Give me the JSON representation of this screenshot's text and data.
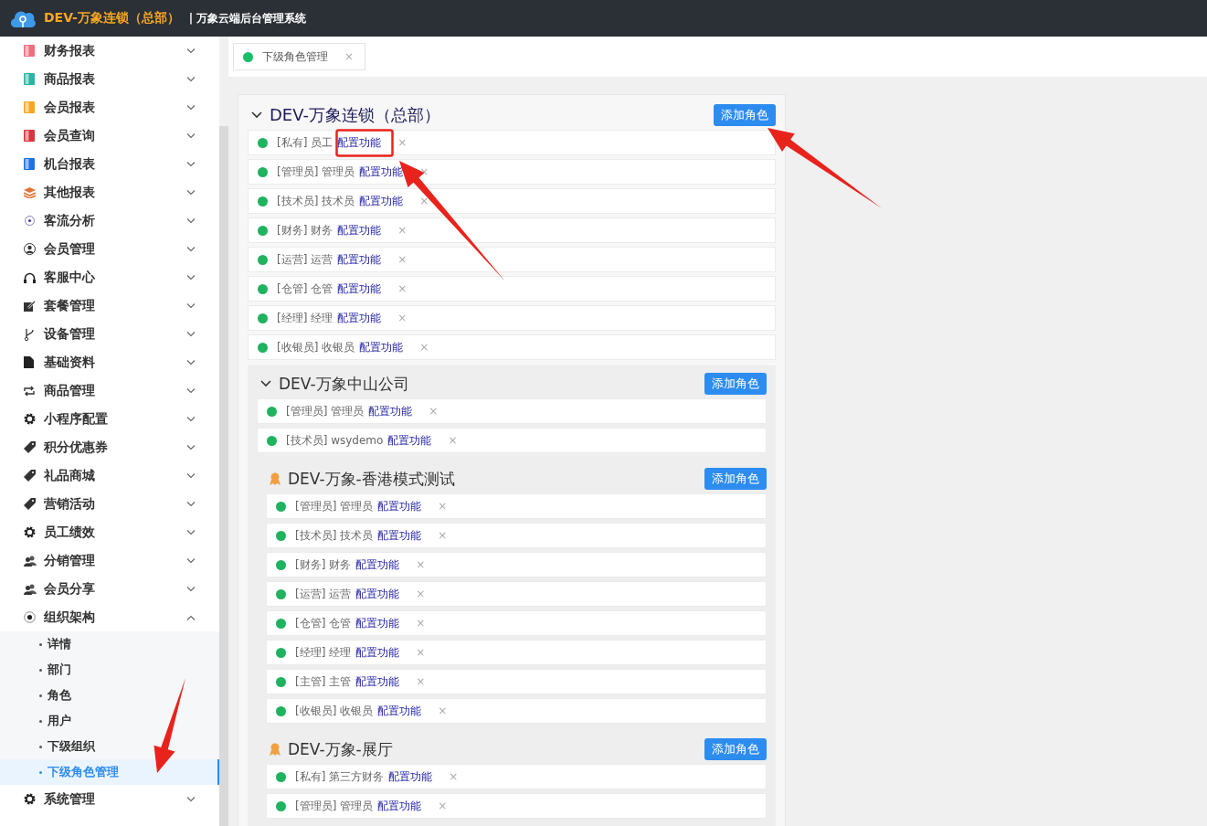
{
  "header": {
    "brand": "DEV-万象连锁（总部）",
    "subtitle": "| 万象云端后台管理系统"
  },
  "sidebar": {
    "items": [
      {
        "label": "财务报表",
        "expanded": false
      },
      {
        "label": "商品报表",
        "expanded": false
      },
      {
        "label": "会员报表",
        "expanded": false
      },
      {
        "label": "会员查询",
        "expanded": false
      },
      {
        "label": "机台报表",
        "expanded": false
      },
      {
        "label": "其他报表",
        "expanded": false
      },
      {
        "label": "客流分析",
        "expanded": false
      },
      {
        "label": "会员管理",
        "expanded": false
      },
      {
        "label": "客服中心",
        "expanded": false
      },
      {
        "label": "套餐管理",
        "expanded": false
      },
      {
        "label": "设备管理",
        "expanded": false
      },
      {
        "label": "基础资料",
        "expanded": false
      },
      {
        "label": "商品管理",
        "expanded": false
      },
      {
        "label": "小程序配置",
        "expanded": false
      },
      {
        "label": "积分优惠券",
        "expanded": false
      },
      {
        "label": "礼品商城",
        "expanded": false
      },
      {
        "label": "营销活动",
        "expanded": false
      },
      {
        "label": "员工绩效",
        "expanded": false
      },
      {
        "label": "分销管理",
        "expanded": false
      },
      {
        "label": "会员分享",
        "expanded": false
      },
      {
        "label": "组织架构",
        "expanded": true,
        "children": [
          {
            "label": "详情",
            "selected": false
          },
          {
            "label": "部门",
            "selected": false
          },
          {
            "label": "角色",
            "selected": false
          },
          {
            "label": "用户",
            "selected": false
          },
          {
            "label": "下级组织",
            "selected": false
          },
          {
            "label": "下级角色管理",
            "selected": true
          }
        ]
      },
      {
        "label": "系统管理",
        "expanded": false
      }
    ]
  },
  "tabs": [
    {
      "label": "下级角色管理",
      "selected": true,
      "close": "×"
    }
  ],
  "tree": {
    "kind": "branch",
    "name": "DEV-万象连锁（总部）",
    "expanded": true,
    "button": "添加角色",
    "roles": [
      {
        "tag": "[私有]",
        "name": "员工",
        "link": "配置功能",
        "close": "×"
      },
      {
        "tag": "[管理员]",
        "name": "管理员",
        "link": "配置功能",
        "close": "×"
      },
      {
        "tag": "[技术员]",
        "name": "技术员",
        "link": "配置功能",
        "close": "×"
      },
      {
        "tag": "[财务]",
        "name": "财务",
        "link": "配置功能",
        "close": "×"
      },
      {
        "tag": "[运营]",
        "name": "运营",
        "link": "配置功能",
        "close": "×"
      },
      {
        "tag": "[仓管]",
        "name": "仓管",
        "link": "配置功能",
        "close": "×"
      },
      {
        "tag": "[经理]",
        "name": "经理",
        "link": "配置功能",
        "close": "×"
      },
      {
        "tag": "[收银员]",
        "name": "收银员",
        "link": "配置功能",
        "close": "×"
      }
    ],
    "children": [
      {
        "kind": "branch",
        "name": "DEV-万象中山公司",
        "expanded": true,
        "button": "添加角色",
        "roles": [
          {
            "tag": "[管理员]",
            "name": "管理员",
            "link": "配置功能",
            "close": "×"
          },
          {
            "tag": "[技术员]",
            "name": "wsydemo",
            "link": "配置功能",
            "close": "×"
          }
        ],
        "children": [
          {
            "kind": "leaf",
            "name": "DEV-万象-香港模式测试",
            "button": "添加角色",
            "roles": [
              {
                "tag": "[管理员]",
                "name": "管理员",
                "link": "配置功能",
                "close": "×"
              },
              {
                "tag": "[技术员]",
                "name": "技术员",
                "link": "配置功能",
                "close": "×"
              },
              {
                "tag": "[财务]",
                "name": "财务",
                "link": "配置功能",
                "close": "×"
              },
              {
                "tag": "[运营]",
                "name": "运营",
                "link": "配置功能",
                "close": "×"
              },
              {
                "tag": "[仓管]",
                "name": "仓管",
                "link": "配置功能",
                "close": "×"
              },
              {
                "tag": "[经理]",
                "name": "经理",
                "link": "配置功能",
                "close": "×"
              },
              {
                "tag": "[主管]",
                "name": "主管",
                "link": "配置功能",
                "close": "×"
              },
              {
                "tag": "[收银员]",
                "name": "收银员",
                "link": "配置功能",
                "close": "×"
              }
            ]
          },
          {
            "kind": "leaf",
            "name": "DEV-万象-展厅",
            "button": "添加角色",
            "roles": [
              {
                "tag": "[私有]",
                "name": "第三方财务",
                "link": "配置功能",
                "close": "×"
              },
              {
                "tag": "[管理员]",
                "name": "管理员",
                "link": "配置功能",
                "close": "×"
              }
            ]
          }
        ]
      }
    ]
  }
}
